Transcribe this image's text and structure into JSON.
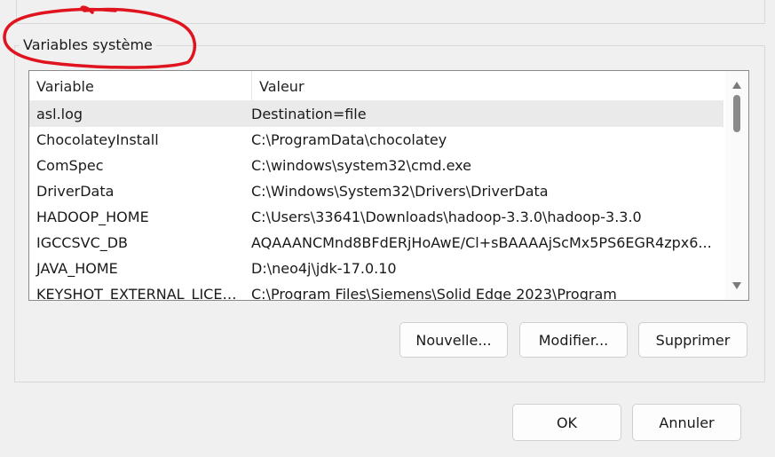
{
  "group": {
    "title": "Variables système"
  },
  "table": {
    "headers": {
      "variable": "Variable",
      "value": "Valeur"
    },
    "rows": [
      {
        "variable": "asl.log",
        "value": "Destination=file"
      },
      {
        "variable": "ChocolateyInstall",
        "value": "C:\\ProgramData\\chocolatey"
      },
      {
        "variable": "ComSpec",
        "value": "C:\\windows\\system32\\cmd.exe"
      },
      {
        "variable": "DriverData",
        "value": "C:\\Windows\\System32\\Drivers\\DriverData"
      },
      {
        "variable": "HADOOP_HOME",
        "value": "C:\\Users\\33641\\Downloads\\hadoop-3.3.0\\hadoop-3.3.0"
      },
      {
        "variable": "IGCCSVC_DB",
        "value": "AQAAANCMnd8BFdERjHoAwE/Cl+sBAAAAjScMx5PS6EGR4zpx6..."
      },
      {
        "variable": "JAVA_HOME",
        "value": "D:\\neo4j\\jdk-17.0.10"
      },
      {
        "variable": "KEYSHOT_EXTERNAL_LICEN...",
        "value": "C:\\Program Files\\Siemens\\Solid Edge 2023\\Program"
      }
    ]
  },
  "buttons": {
    "new": "Nouvelle...",
    "edit": "Modifier...",
    "delete": "Supprimer",
    "ok": "OK",
    "cancel": "Annuler"
  },
  "icons": {
    "scroll_up": "chevron-up-icon",
    "scroll_down": "chevron-down-icon"
  },
  "colors": {
    "annotation": "#e0141e",
    "selected_row": "#eaeaea"
  }
}
